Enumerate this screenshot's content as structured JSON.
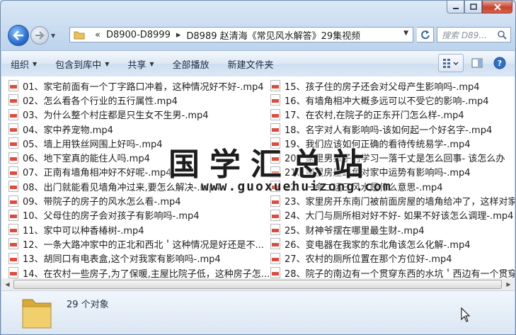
{
  "address": {
    "crumbs": [
      "D8900-D8999",
      "D8989 赵清海《常见风水解答》29集视频"
    ]
  },
  "search": {
    "placeholder": "搜索 D89..."
  },
  "toolbar": {
    "organize": "组织",
    "include_library": "包含到库中",
    "share": "共享",
    "play_all": "全部播放",
    "new_folder": "新建文件夹"
  },
  "files_left": [
    "01、家宅前面有一个丁字路口冲着，这种情况好不好-.mp4",
    "02、怎么看各个行业的五行属性.mp4",
    "03、为什么整个村庄都是只生女不生男-.mp4",
    "04、家中养宠物.mp4",
    "05、墙上用铁丝网围上好吗-.mp4",
    "06、地下室真的能住人吗.mp4",
    "07、正南有墙角相冲好不好呢-.mp4",
    "08、出门就能看见墙角冲过来,要怎么解决-.mp4",
    "09、带院子的房子的风水怎么看-.mp4",
    "10、父母住的房子会对孩子有影响吗-.mp4",
    "11、家中可以种香椿树-.mp4",
    "12、一条大路冲家中的正北和西北＇这种情况是好还是不...",
    "13、胡同口有电表盒,这个对我家有影响吗-.mp4",
    "14、在农村一些房子,为了保暖,主屋比院子低，这种房子怎..."
  ],
  "files_right": [
    "15、孩子住的房子还会对父母产生影响吗-.mp4",
    "16、有墙角相冲大概多远可以不受它的影响-.mp4",
    "17、在农村,在院子的正东开门怎么样-.mp4",
    "18、名字对人有影响吗-该如何起一个好名字-.mp4",
    "19、我们应该如何正确的看待传统易学-.mp4",
    "20、家里男孩子的学习一落千丈是怎么回事- 该怎么办",
    "21、家里房屋缺角对家中运势有影响吗-.mp4",
    "22、一命二运三风水是什么意思-.mp4",
    "23、家里房开东南门被前面房屋的墙角给冲了，这样对家",
    "24、大门与厕所相对好不好- 如果不好该怎么调理-.mp4",
    "25、财神爷摆在哪里最生财-.mp4",
    "26、变电器在我家的东北角该怎么化解-.mp4",
    "27、农村的厕所位置在那个方位好-.mp4",
    "28、院子的南边有一个贯穿东西的水坑＇西边有一个贯穿"
  ],
  "watermark": {
    "title": "国学汇总站",
    "url": "www.guoxuehuizong.com"
  },
  "status": {
    "count": "29 个对象"
  }
}
